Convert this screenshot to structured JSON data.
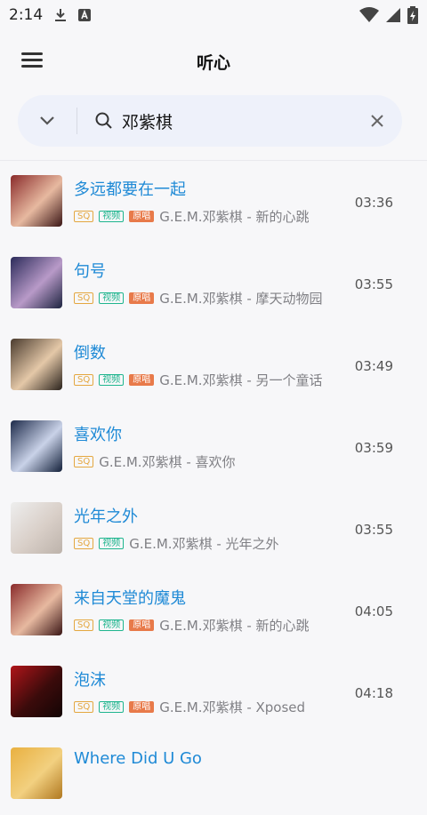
{
  "status_bar": {
    "time": "2:14"
  },
  "app_bar": {
    "title": "听心"
  },
  "search": {
    "query": "邓紫棋"
  },
  "badge_labels": {
    "sq": "SQ",
    "mv": "视频",
    "original": "原唱"
  },
  "colors": {
    "accent": "#1f8ad6",
    "sq": "#e4a740",
    "mv": "#1fb58e",
    "original": "#e87a4a"
  },
  "songs": [
    {
      "title": "多远都要在一起",
      "artist_album": "G.E.M.邓紫棋 - 新的心跳",
      "duration": "03:36",
      "badges": [
        "sq",
        "mv",
        "original"
      ]
    },
    {
      "title": "句号",
      "artist_album": "G.E.M.邓紫棋 - 摩天动物园",
      "duration": "03:55",
      "badges": [
        "sq",
        "mv",
        "original"
      ]
    },
    {
      "title": "倒数",
      "artist_album": "G.E.M.邓紫棋 - 另一个童话",
      "duration": "03:49",
      "badges": [
        "sq",
        "mv",
        "original"
      ]
    },
    {
      "title": "喜欢你",
      "artist_album": "G.E.M.邓紫棋 - 喜欢你",
      "duration": "03:59",
      "badges": [
        "sq"
      ]
    },
    {
      "title": "光年之外",
      "artist_album": "G.E.M.邓紫棋 - 光年之外",
      "duration": "03:55",
      "badges": [
        "sq",
        "mv"
      ]
    },
    {
      "title": "来自天堂的魔鬼",
      "artist_album": "G.E.M.邓紫棋 - 新的心跳",
      "duration": "04:05",
      "badges": [
        "sq",
        "mv",
        "original"
      ]
    },
    {
      "title": "泡沫",
      "artist_album": "G.E.M.邓紫棋 - Xposed",
      "duration": "04:18",
      "badges": [
        "sq",
        "mv",
        "original"
      ]
    },
    {
      "title": "Where Did U Go",
      "artist_album": "",
      "duration": "",
      "badges": []
    }
  ]
}
